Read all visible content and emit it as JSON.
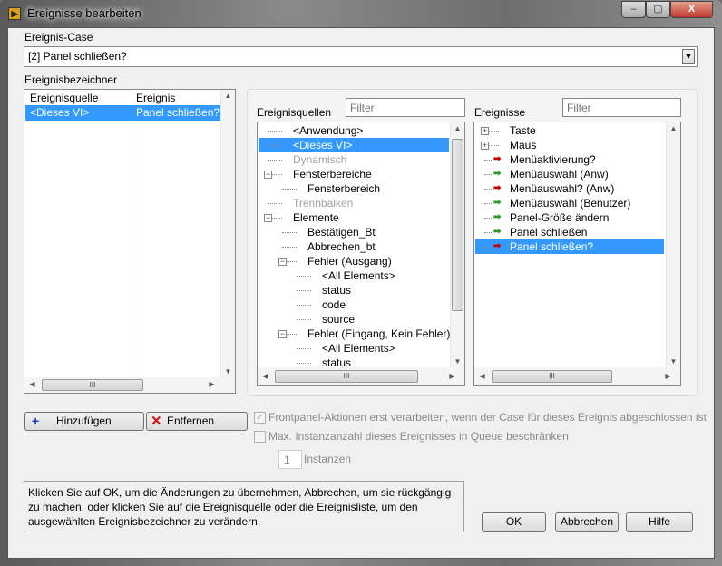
{
  "window": {
    "title": "Ereignisse bearbeiten",
    "minimize": "‒",
    "maximize": "▢",
    "close": "X"
  },
  "event_case": {
    "label": "Ereignis-Case",
    "value": "[2] Panel schließen?"
  },
  "specifiers": {
    "label": "Ereignisbezeichner",
    "columns": [
      "Ereignisquelle",
      "Ereignis"
    ],
    "rows": [
      {
        "source": "<Dieses VI>",
        "event": "Panel schließen?"
      }
    ]
  },
  "sources": {
    "label": "Ereignisquellen",
    "filter_placeholder": "Filter",
    "items": [
      {
        "text": "<Anwendung>",
        "level": 0,
        "exp": "",
        "dis": false,
        "sel": false
      },
      {
        "text": "<Dieses VI>",
        "level": 0,
        "exp": "",
        "dis": false,
        "sel": true
      },
      {
        "text": "Dynamisch",
        "level": 0,
        "exp": "",
        "dis": true,
        "sel": false
      },
      {
        "text": "Fensterbereiche",
        "level": 0,
        "exp": "−",
        "dis": false,
        "sel": false
      },
      {
        "text": "Fensterbereich",
        "level": 1,
        "exp": "",
        "dis": false,
        "sel": false
      },
      {
        "text": "Trennbalken",
        "level": 0,
        "exp": "",
        "dis": true,
        "sel": false
      },
      {
        "text": "Elemente",
        "level": 0,
        "exp": "−",
        "dis": false,
        "sel": false
      },
      {
        "text": "Bestätigen_Bt",
        "level": 1,
        "exp": "",
        "dis": false,
        "sel": false
      },
      {
        "text": "Abbrechen_bt",
        "level": 1,
        "exp": "",
        "dis": false,
        "sel": false
      },
      {
        "text": "Fehler (Ausgang)",
        "level": 1,
        "exp": "−",
        "dis": false,
        "sel": false
      },
      {
        "text": "<All Elements>",
        "level": 2,
        "exp": "",
        "dis": false,
        "sel": false
      },
      {
        "text": "status",
        "level": 2,
        "exp": "",
        "dis": false,
        "sel": false
      },
      {
        "text": "code",
        "level": 2,
        "exp": "",
        "dis": false,
        "sel": false
      },
      {
        "text": "source",
        "level": 2,
        "exp": "",
        "dis": false,
        "sel": false
      },
      {
        "text": "Fehler (Eingang, Kein Fehler)",
        "level": 1,
        "exp": "−",
        "dis": false,
        "sel": false
      },
      {
        "text": "<All Elements>",
        "level": 2,
        "exp": "",
        "dis": false,
        "sel": false
      },
      {
        "text": "status",
        "level": 2,
        "exp": "",
        "dis": false,
        "sel": false
      }
    ]
  },
  "events": {
    "label": "Ereignisse",
    "filter_placeholder": "Filter",
    "items": [
      {
        "text": "Taste",
        "exp": "+",
        "arrow": "",
        "sel": false
      },
      {
        "text": "Maus",
        "exp": "+",
        "arrow": "",
        "sel": false
      },
      {
        "text": "Menüaktivierung?",
        "exp": "",
        "arrow": "#cc0000",
        "sel": false
      },
      {
        "text": "Menüauswahl (Anw)",
        "exp": "",
        "arrow": "#2a9a2a",
        "sel": false
      },
      {
        "text": "Menüauswahl? (Anw)",
        "exp": "",
        "arrow": "#cc0000",
        "sel": false
      },
      {
        "text": "Menüauswahl (Benutzer)",
        "exp": "",
        "arrow": "#2a9a2a",
        "sel": false
      },
      {
        "text": "Panel-Größe ändern",
        "exp": "",
        "arrow": "#2a9a2a",
        "sel": false
      },
      {
        "text": "Panel schließen",
        "exp": "",
        "arrow": "#2a9a2a",
        "sel": false
      },
      {
        "text": "Panel schließen?",
        "exp": "",
        "arrow": "#cc0000",
        "sel": true
      }
    ]
  },
  "buttons": {
    "add": "Hinzufügen",
    "remove": "Entfernen",
    "ok": "OK",
    "cancel": "Abbrechen",
    "help": "Hilfe"
  },
  "options": {
    "frontpanel_label": "Frontpanel-Aktionen erst verarbeiten, wenn der Case für dieses Ereignis abgeschlossen ist",
    "frontpanel_checked": true,
    "limit_label": "Max. Instanzanzahl dieses Ereignisses in Queue beschränken",
    "limit_checked": false,
    "instances_value": "1",
    "instances_label": "Instanzen"
  },
  "help_text": "Klicken Sie auf OK, um die Änderungen zu übernehmen, Abbrechen, um sie rückgängig zu machen, oder klicken Sie auf die Ereignisquelle oder die Ereignisliste, um den ausgewählten Ereignisbezeichner zu verändern."
}
